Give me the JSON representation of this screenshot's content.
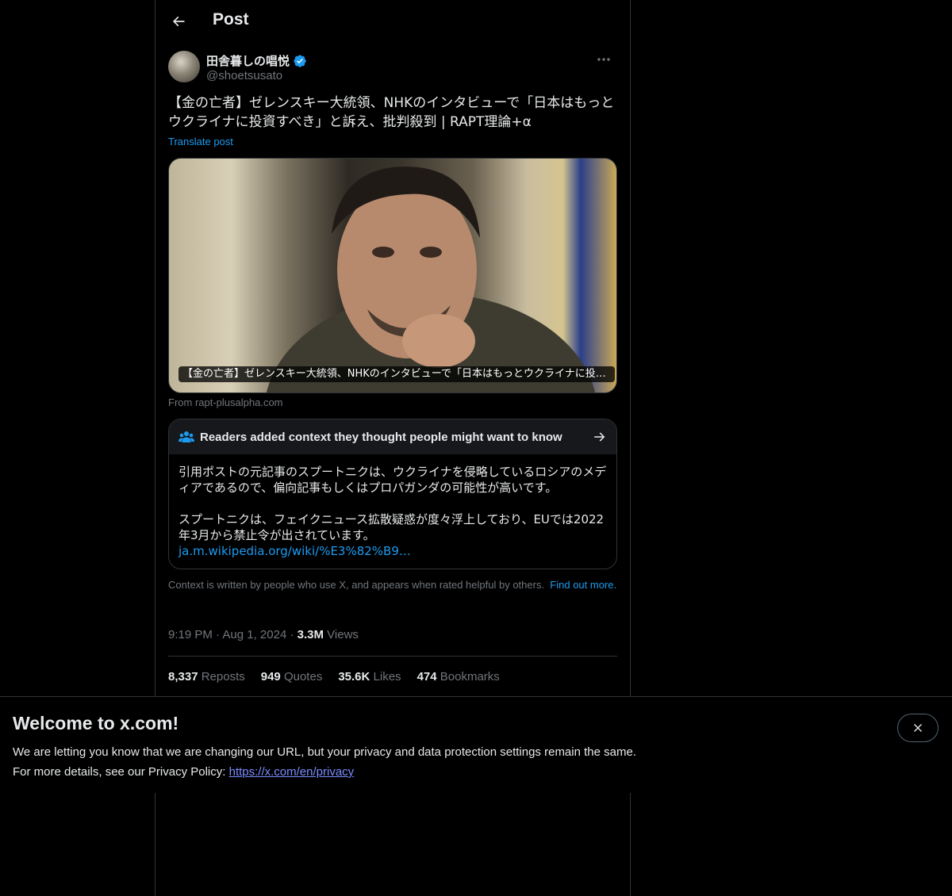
{
  "header": {
    "title": "Post"
  },
  "post": {
    "display_name": "田舎暮しの唱悦",
    "handle": "@shoetsusato",
    "text": "【金の亡者】ゼレンスキー大統領、NHKのインタビューで「日本はもっとウクライナに投資すべき」と訴え、批判殺到 | RAPT理論+α",
    "translate_label": "Translate post",
    "media_caption": "【金の亡者】ゼレンスキー大統領、NHKのインタビューで「日本はもっとウクライナに投資すべき」と訴え、批判殺到 | RAPT理論+α",
    "source": "From rapt-plusalpha.com",
    "time": "9:19 PM",
    "date": "Aug 1, 2024",
    "views_count": "3.3M",
    "views_label": "Views",
    "stats": [
      {
        "count": "8,337",
        "label": "Reposts"
      },
      {
        "count": "949",
        "label": "Quotes"
      },
      {
        "count": "35.6K",
        "label": "Likes"
      },
      {
        "count": "474",
        "label": "Bookmarks"
      }
    ]
  },
  "community_note": {
    "title": "Readers added context they thought people might want to know",
    "paragraph1": "引用ポストの元記事のスプートニクは、ウクライナを侵略しているロシアのメディアであるので、偏向記事もしくはプロパガンダの可能性が高いです。",
    "paragraph2": "スプートニクは、フェイクニュース拡散疑惑が度々浮上しており、EUでは2022年3月から禁止令が出されています。",
    "link": "ja.m.wikipedia.org/wiki/%E3%82%B9…",
    "disclaimer": "Context is written by people who use X, and appears when rated helpful by others.",
    "find_out_more": "Find out more."
  },
  "banner": {
    "title": "Welcome to x.com!",
    "line1": "We are letting you know that we are changing our URL, but your privacy and data protection settings remain the same.",
    "line2_prefix": "For more details, see our Privacy Policy:",
    "privacy_link": "https://x.com/en/privacy"
  },
  "colors": {
    "accent": "#1d9bf0",
    "background": "#000000",
    "border": "#2f3336",
    "muted_text": "#71767b"
  },
  "icons": [
    "back-arrow-icon",
    "verified-badge-icon",
    "more-dots-icon",
    "people-icon",
    "arrow-right-icon",
    "close-icon"
  ]
}
